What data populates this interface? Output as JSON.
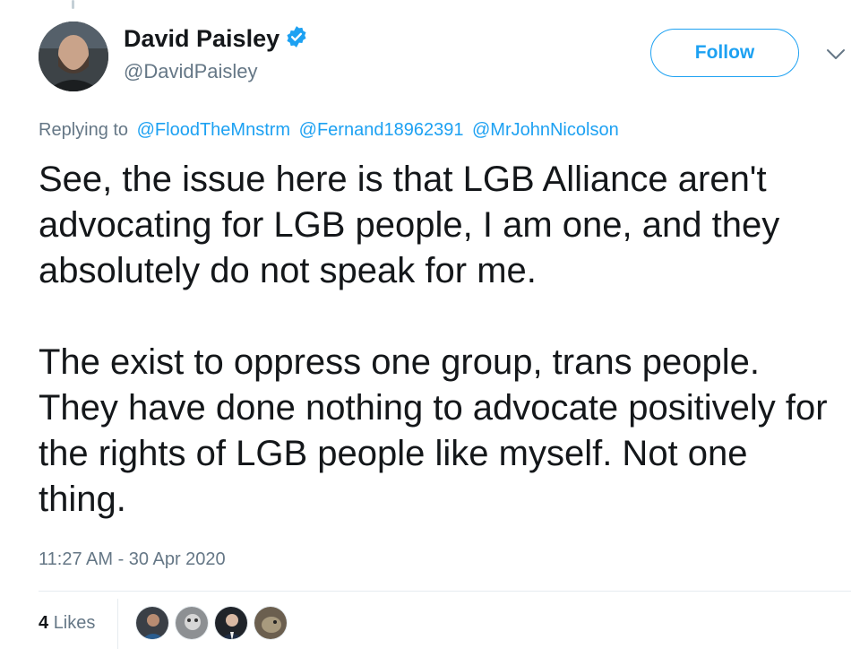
{
  "tweet": {
    "author": {
      "display_name": "David Paisley",
      "handle": "@DavidPaisley",
      "verified": true,
      "avatar_icon": "profile-photo-icon"
    },
    "follow_label": "Follow",
    "menu_icon": "chevron-down-icon",
    "replying_to_prefix": "Replying to",
    "replying_to": [
      "@FloodTheMnstrm",
      "@Fernand18962391",
      "@MrJohnNicolson"
    ],
    "paragraphs": [
      "See, the issue here is that LGB Alliance aren't advocating for LGB people, I am one, and they absolutely do not speak for me.",
      "The exist to oppress one group, trans people. They have done nothing to advocate positively for the rights of LGB people like myself. Not one thing."
    ],
    "timestamp": "11:27 AM - 30 Apr 2020",
    "likes_count": "4",
    "likes_label": "Likes",
    "liker_avatars": [
      "liker-avatar-icon",
      "liker-avatar-icon",
      "liker-avatar-icon",
      "liker-avatar-icon"
    ]
  },
  "colors": {
    "accent": "#1da1f2",
    "text_primary": "#14171a",
    "text_secondary": "#657786",
    "divider": "#e6ecf0"
  }
}
